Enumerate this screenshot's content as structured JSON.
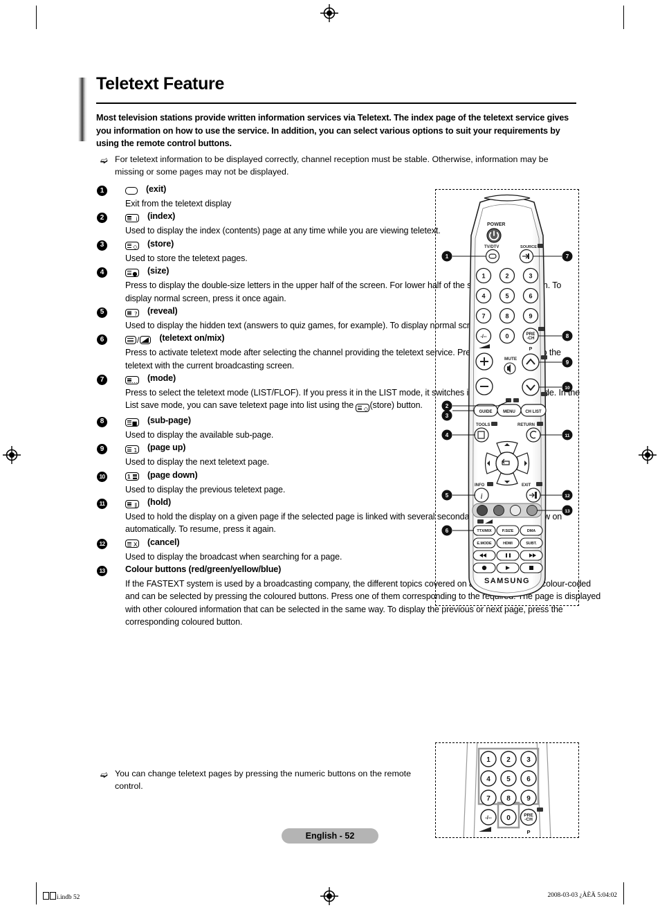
{
  "page": {
    "title": "Teletext Feature",
    "page_tag": "English - 52",
    "footer_left_file": "i.indb  52",
    "footer_right": "2008-03-03   ¿ÀÈÄ 5:04:02"
  },
  "intro": "Most television stations provide written information services via Teletext. The index page of the teletext service gives you information on how to use the service. In addition, you can select various options to suit your requirements by using the remote control buttons.",
  "note_top": "For teletext information to be displayed correctly, channel reception must be stable. Otherwise, information may be missing or some pages may not be displayed.",
  "note_bottom": "You can change teletext pages by pressing the numeric buttons on the remote control.",
  "items": [
    {
      "num": "1",
      "icon": "exit-key-icon",
      "label": "(exit)",
      "body": "Exit from the teletext display"
    },
    {
      "num": "2",
      "icon": "index-key-icon",
      "label": "(index)",
      "body": "Used to display the index (contents) page at any time while you are viewing teletext."
    },
    {
      "num": "3",
      "icon": "store-key-icon",
      "label": "(store)",
      "body": "Used to store the teletext pages."
    },
    {
      "num": "4",
      "icon": "size-key-icon",
      "label": "(size)",
      "body": "Press to display the double-size letters in the upper half of the screen. For lower half of the screen, press it again. To display normal screen, press it once again."
    },
    {
      "num": "5",
      "icon": "reveal-key-icon",
      "label": "(reveal)",
      "body": "Used to display the hidden text (answers to quiz games, for example). To display normal screen, press it again."
    },
    {
      "num": "6",
      "icon": "teletext-on-mix-key-icon",
      "label": "(teletext on/mix)",
      "body": "Press to activate teletext mode after selecting the channel providing the teletext service. Press it twice to overlap the teletext with the current broadcasting screen."
    },
    {
      "num": "7",
      "icon": "mode-key-icon",
      "label": "(mode)",
      "body_part1": "Press to select the teletext mode (LIST/FLOF). If you press it in the LIST mode, it switches into the List save mode. In the List save mode, you can save teletext page into list using the ",
      "body_part2": "(store) button."
    },
    {
      "num": "8",
      "icon": "sub-page-key-icon",
      "label": "(sub-page)",
      "body": "Used to display the available sub-page."
    },
    {
      "num": "9",
      "icon": "page-up-key-icon",
      "label": "(page up)",
      "body": "Used to display the next teletext page."
    },
    {
      "num": "10",
      "icon": "page-down-key-icon",
      "label": "(page down)",
      "body": "Used to display the previous teletext page."
    },
    {
      "num": "11",
      "icon": "hold-key-icon",
      "label": "(hold)",
      "body": "Used to hold the display on a given page if the selected page is linked with several secondary pages which follow on automatically. To resume, press it again."
    },
    {
      "num": "12",
      "icon": "cancel-key-icon",
      "label": "(cancel)",
      "body": "Used to display the broadcast when searching for a page."
    },
    {
      "num": "13",
      "icon": "colour-buttons-icon",
      "label": "Colour buttons (red/green/yellow/blue)",
      "body": "If the FASTEXT system is used by a broadcasting company, the different topics covered on a teletext page are colour-coded and can be selected by pressing the coloured buttons. Press one of them corresponding to the required. The page is displayed with other coloured information that can be selected in the same way. To display the previous or next page, press the corresponding coloured button."
    }
  ],
  "remote": {
    "brand": "SAMSUNG",
    "power_label": "POWER",
    "tv_dtv_label": "TV/DTV",
    "source_label": "SOURCE",
    "mute_label": "MUTE",
    "pre_ch_label_1": "PRE",
    "pre_ch_label_2": "-CH",
    "p_label": "P",
    "guide_label": "GUIDE",
    "menu_label": "MENU",
    "chlist_label": "CH LIST",
    "tools_label": "TOOLS",
    "return_label": "RETURN",
    "info_label": "INFO",
    "exit_label": "EXIT",
    "keys_row1": [
      "1",
      "2",
      "3"
    ],
    "keys_row2": [
      "4",
      "5",
      "6"
    ],
    "keys_row3": [
      "7",
      "8",
      "9"
    ],
    "keys_row4": [
      "-/--",
      "0"
    ],
    "fn_row1": [
      "TTX/MIX",
      "P.SIZE",
      "DMA"
    ],
    "fn_row2": [
      "E.MODE",
      "HDMI",
      "SUBT."
    ],
    "callouts": [
      "1",
      "2",
      "3",
      "4",
      "5",
      "6",
      "7",
      "8",
      "9",
      "10",
      "11",
      "12",
      "13"
    ],
    "colour_buttons": [
      "#4a4a4a",
      "#6e6e6e",
      "#eaeaea",
      "#9a9a9a"
    ]
  },
  "colors": {
    "page_tag_bg": "#b4b4b4",
    "text": "#000000",
    "remote_body": "#ffffff",
    "remote_outline": "#1a1a1a"
  }
}
